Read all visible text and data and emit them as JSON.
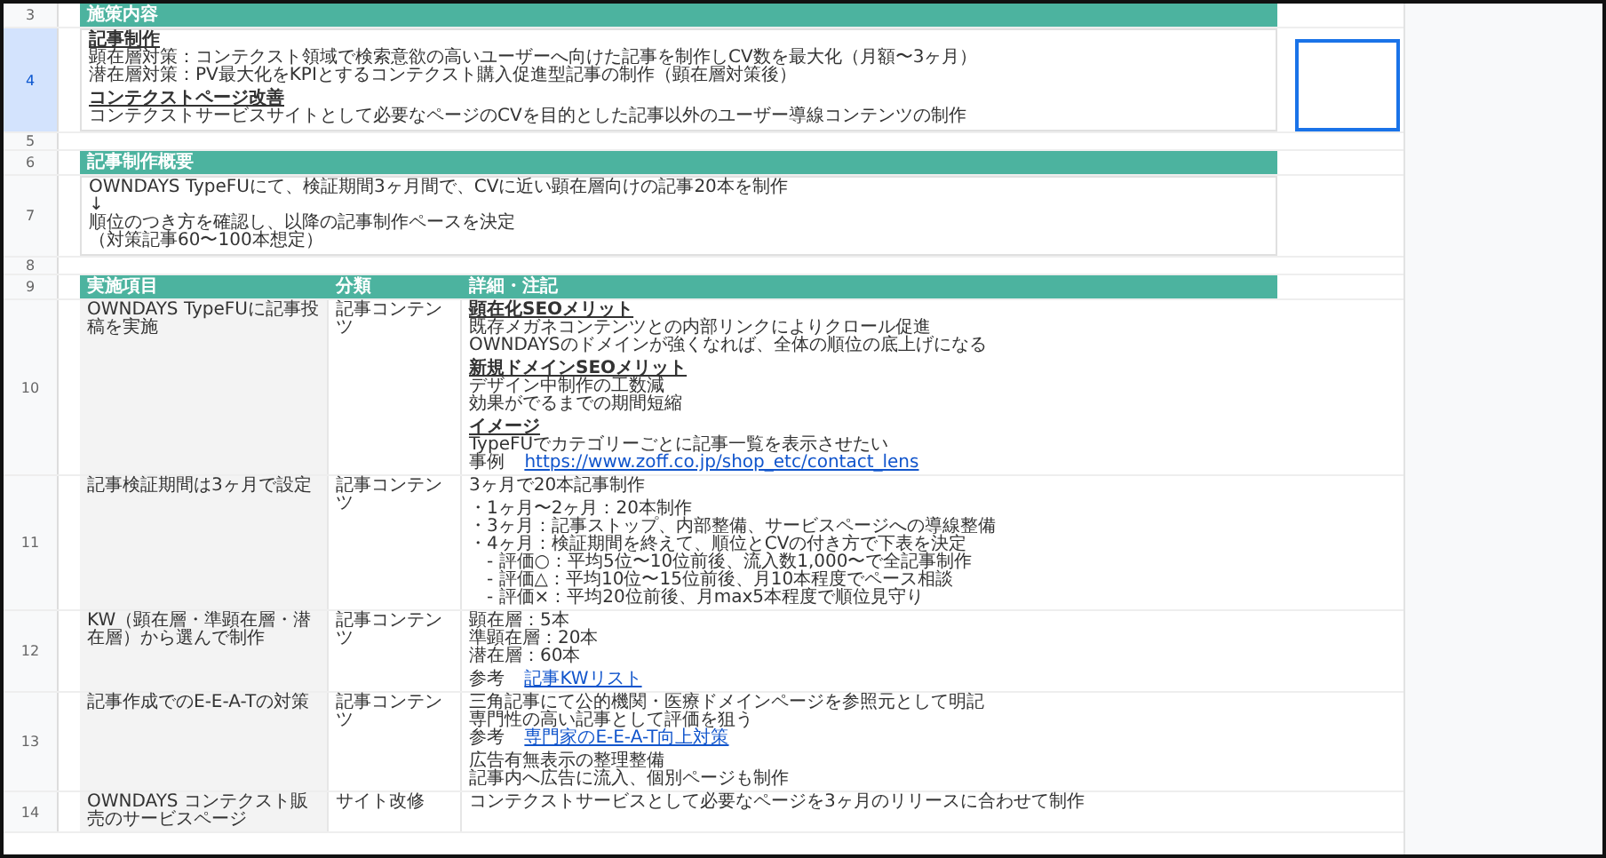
{
  "rows": [
    {
      "kind": "section_header",
      "row_number": "3",
      "selected": false,
      "text": "施策内容"
    },
    {
      "kind": "text_block",
      "row_number": "4",
      "selected": true,
      "paragraphs": [
        {
          "title": "記事制作",
          "lines": [
            {
              "text": "顕在層対策：コンテクスト領域で検索意欲の高いユーザーへ向けた記事を制作しCV数を最大化（月額〜3ヶ月）"
            },
            {
              "text": "潜在層対策：PV最大化をKPIとするコンテクスト購入促進型記事の制作（顕在層対策後）"
            }
          ]
        },
        {
          "title": "コンテクストページ改善",
          "lines": [
            {
              "text": "コンテクストサービスサイトとして必要なページのCVを目的とした記事以外のユーザー導線コンテンツの制作"
            }
          ]
        }
      ]
    },
    {
      "kind": "spacer",
      "row_number": "5",
      "selected": false
    },
    {
      "kind": "section_header",
      "row_number": "6",
      "selected": false,
      "text": "記事制作概要"
    },
    {
      "kind": "text_block",
      "row_number": "7",
      "selected": false,
      "paragraphs": [
        {
          "lines": [
            {
              "text": "OWNDAYS TypeFUにて、検証期間3ヶ月間で、CVに近い顕在層向けの記事20本を制作"
            },
            {
              "text": "↓"
            },
            {
              "text": "順位のつき方を確認し、以降の記事制作ペースを決定"
            },
            {
              "text": "（対策記事60〜100本想定）"
            }
          ]
        }
      ]
    },
    {
      "kind": "spacer",
      "row_number": "8",
      "selected": false
    },
    {
      "kind": "table_header",
      "row_number": "9",
      "selected": false,
      "columns": [
        "実施項目",
        "分類",
        "詳細・注記"
      ]
    },
    {
      "kind": "table_row",
      "row_number": "10",
      "selected": false,
      "item": "OWNDAYS TypeFUに記事投稿を実施",
      "category": "記事コンテンツ",
      "paragraphs": [
        {
          "title": "顕在化SEOメリット",
          "lines": [
            {
              "text": "既存メガネコンテンツとの内部リンクによりクロール促進"
            },
            {
              "text": "OWNDAYSのドメインが強くなれば、全体の順位の底上げになる"
            }
          ]
        },
        {
          "title": "新規ドメインSEOメリット",
          "lines": [
            {
              "text": "デザイン中制作の工数減"
            },
            {
              "text": "効果がでるまでの期間短縮"
            }
          ]
        },
        {
          "title": "イメージ",
          "lines": [
            {
              "text": "TypeFUでカテゴリーごとに記事一覧を表示させたい"
            },
            {
              "text": "事例",
              "link": "https://www.zoff.co.jp/shop_etc/contact_lens"
            }
          ]
        }
      ]
    },
    {
      "kind": "table_row",
      "row_number": "11",
      "selected": false,
      "item": "記事検証期間は3ヶ月で設定",
      "category": "記事コンテンツ",
      "paragraphs": [
        {
          "lines": [
            {
              "text": "3ヶ月で20本記事制作"
            }
          ]
        },
        {
          "lines": [
            {
              "text": "・1ヶ月〜2ヶ月：20本制作"
            },
            {
              "text": "・3ヶ月：記事ストップ、内部整備、サービスページへの導線整備"
            },
            {
              "text": "・4ヶ月：検証期間を終えて、順位とCVの付き方で下表を決定"
            },
            {
              "text": "　- 評価○：平均5位〜10位前後、流入数1,000〜で全記事制作"
            },
            {
              "text": "　- 評価△：平均10位〜15位前後、月10本程度でペース相談"
            },
            {
              "text": "　- 評価×：平均20位前後、月max5本程度で順位見守り"
            }
          ]
        }
      ]
    },
    {
      "kind": "table_row",
      "row_number": "12",
      "selected": false,
      "item": "KW（顕在層・準顕在層・潜在層）から選んで制作",
      "category": "記事コンテンツ",
      "paragraphs": [
        {
          "lines": [
            {
              "text": "顕在層：5本"
            },
            {
              "text": "準顕在層：20本"
            },
            {
              "text": "潜在層：60本"
            }
          ]
        },
        {
          "lines": [
            {
              "text": "参考",
              "link": "記事KWリスト"
            }
          ]
        }
      ]
    },
    {
      "kind": "table_row",
      "row_number": "13",
      "selected": false,
      "item": "記事作成でのE-E-A-Tの対策",
      "category": "記事コンテンツ",
      "paragraphs": [
        {
          "lines": [
            {
              "text": "三角記事にて公的機関・医療ドメインページを参照元として明記"
            },
            {
              "text": "専門性の高い記事として評価を狙う"
            },
            {
              "text": "参考",
              "link": "専門家のE-E-A-T向上対策"
            }
          ]
        },
        {
          "lines": [
            {
              "text": "広告有無表示の整理整備"
            },
            {
              "text": "記事内へ広告に流入、個別ページも制作"
            }
          ]
        }
      ]
    },
    {
      "kind": "table_row",
      "row_number": "14",
      "selected": false,
      "item": "OWNDAYS コンテクスト販売のサービスページ",
      "category": "サイト改修",
      "paragraphs": [
        {
          "lines": [
            {
              "text": "コンテクストサービスとして必要なページを3ヶ月のリリースに合わせて制作"
            }
          ]
        }
      ]
    }
  ]
}
